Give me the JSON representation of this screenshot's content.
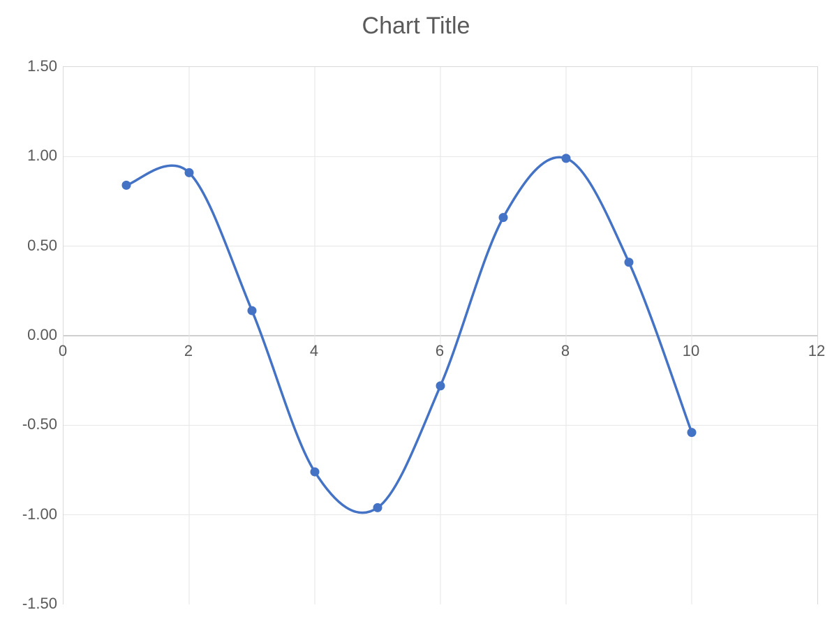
{
  "title": "Chart Title",
  "chart_data": {
    "type": "line",
    "title": "Chart Title",
    "xlabel": "",
    "ylabel": "",
    "xlim": [
      0,
      12
    ],
    "ylim": [
      -1.5,
      1.5
    ],
    "xticks": [
      0,
      2,
      4,
      6,
      8,
      10,
      12
    ],
    "yticks": [
      -1.5,
      -1.0,
      -0.5,
      0.0,
      0.5,
      1.0,
      1.5
    ],
    "xtick_labels": [
      "0",
      "2",
      "4",
      "6",
      "8",
      "10",
      "12"
    ],
    "ytick_labels": [
      "-1.50",
      "-1.00",
      "-0.50",
      "0.00",
      "0.50",
      "1.00",
      "1.50"
    ],
    "x": [
      1,
      2,
      3,
      4,
      5,
      6,
      7,
      8,
      9,
      10
    ],
    "values": [
      0.84,
      0.91,
      0.14,
      -0.76,
      -0.96,
      -0.28,
      0.66,
      0.99,
      0.41,
      -0.54
    ],
    "series_color": "#4472C4",
    "grid": true,
    "smooth": true
  }
}
